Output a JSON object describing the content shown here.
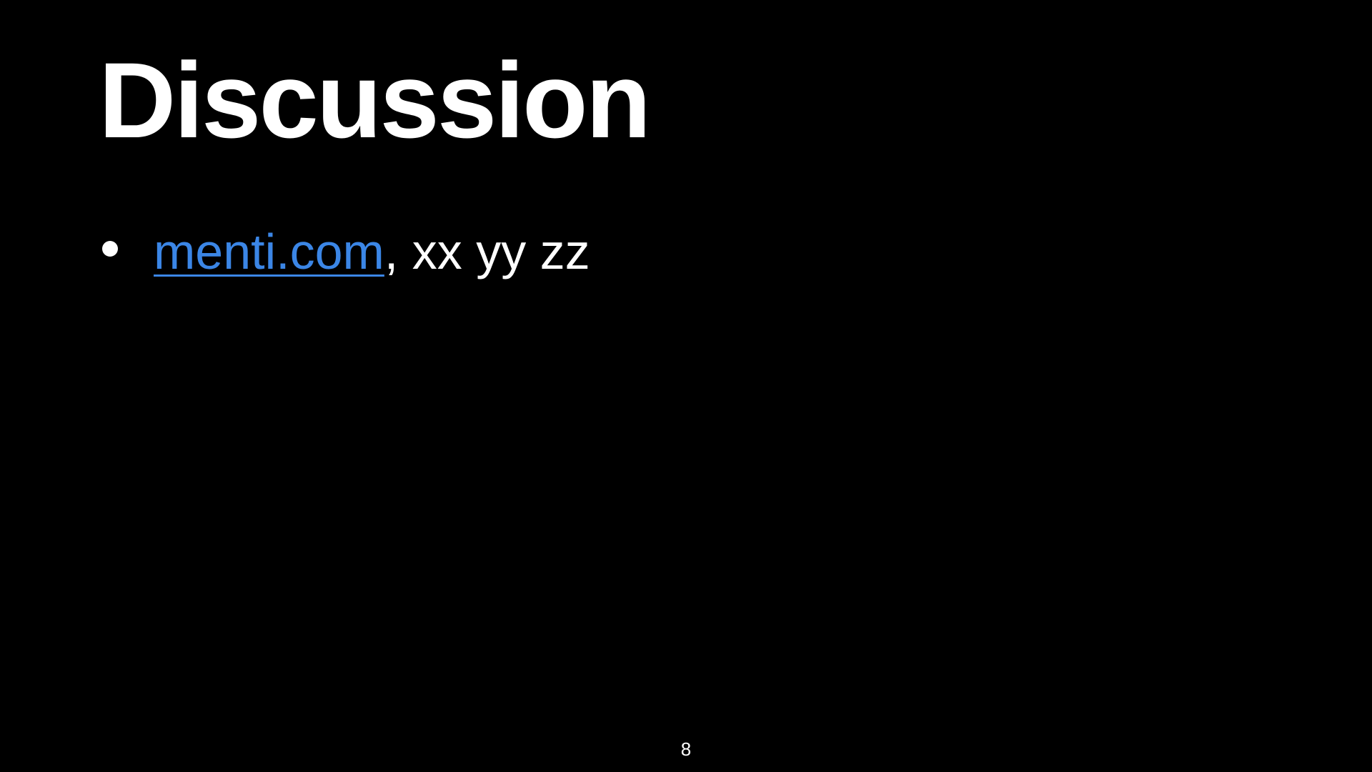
{
  "slide": {
    "title": "Discussion",
    "bullets": [
      {
        "link_text": "menti.com",
        "rest_text": ", xx yy zz"
      }
    ],
    "page_number": "8"
  },
  "colors": {
    "background": "#000000",
    "text": "#ffffff",
    "link": "#3b86e6"
  },
  "icons": {
    "bullet": "bullet-dot-icon"
  }
}
